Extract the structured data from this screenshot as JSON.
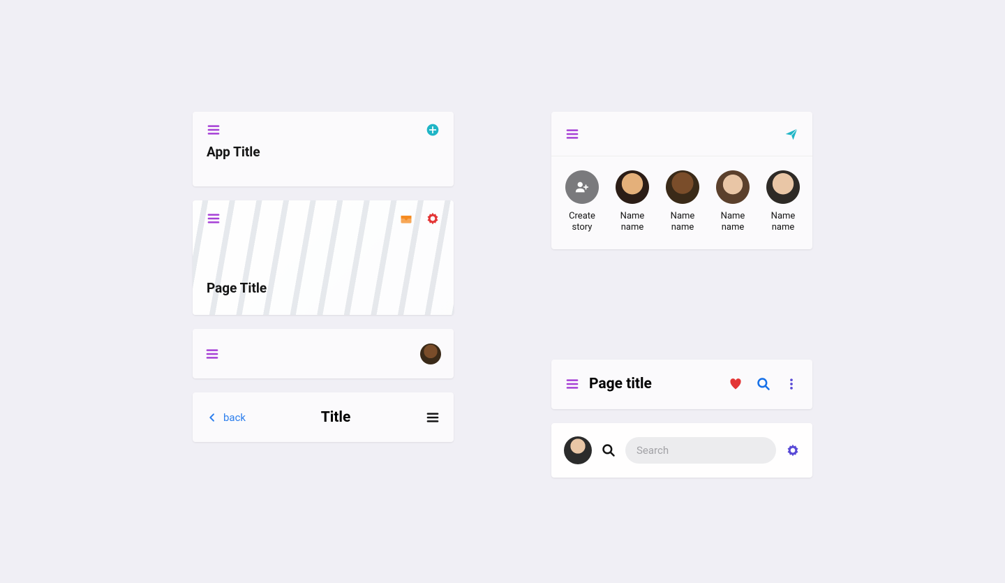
{
  "card1": {
    "title": "App Title"
  },
  "card2": {
    "title": "Page Title"
  },
  "card4": {
    "back": "back",
    "title": "Title"
  },
  "stories": {
    "items": [
      {
        "label": "Create\nstory"
      },
      {
        "label": "Name\nname"
      },
      {
        "label": "Name\nname"
      },
      {
        "label": "Name\nname"
      },
      {
        "label": "Name\nname"
      }
    ]
  },
  "card6": {
    "title": "Page title"
  },
  "card7": {
    "placeholder": "Search"
  }
}
